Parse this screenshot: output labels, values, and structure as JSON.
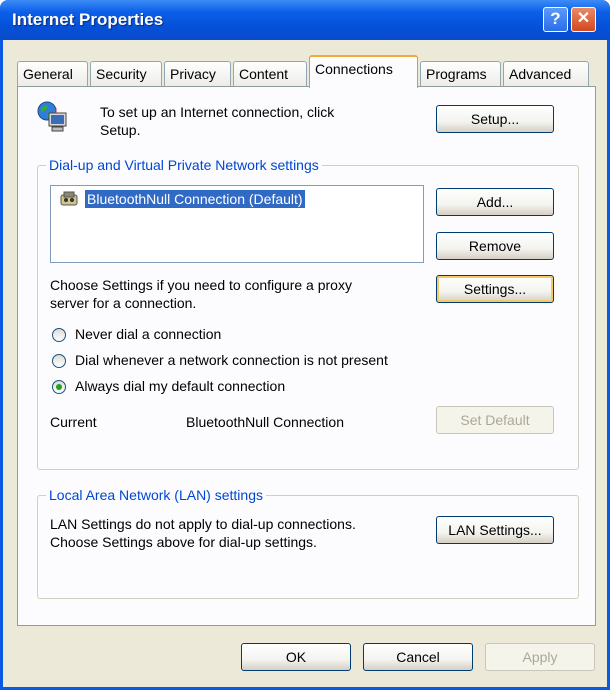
{
  "window": {
    "title": "Internet Properties",
    "help_glyph": "?",
    "close_glyph": "✕"
  },
  "tabs": [
    "General",
    "Security",
    "Privacy",
    "Content",
    "Connections",
    "Programs",
    "Advanced"
  ],
  "active_tab": "Connections",
  "setup": {
    "text_line1": "To set up an Internet connection, click",
    "text_line2": "Setup.",
    "button": "Setup..."
  },
  "dialup": {
    "legend": "Dial-up and Virtual Private Network settings",
    "connections": [
      "BluetoothNull Connection (Default)"
    ],
    "add_button": "Add...",
    "remove_button": "Remove",
    "settings_text_line1": "Choose Settings if you need to configure a proxy",
    "settings_text_line2": "server for a connection.",
    "settings_button": "Settings...",
    "options": [
      {
        "label": "Never dial a connection",
        "selected": false
      },
      {
        "label": "Dial whenever a network connection is not present",
        "selected": false
      },
      {
        "label": "Always dial my default connection",
        "selected": true
      }
    ],
    "current_label": "Current",
    "current_value": "BluetoothNull Connection",
    "set_default_button": "Set Default"
  },
  "lan": {
    "legend": "Local Area Network (LAN) settings",
    "text_line1": "LAN Settings do not apply to dial-up connections.",
    "text_line2": "Choose Settings above for dial-up settings.",
    "button": "LAN Settings..."
  },
  "footer": {
    "ok": "OK",
    "cancel": "Cancel",
    "apply": "Apply"
  }
}
